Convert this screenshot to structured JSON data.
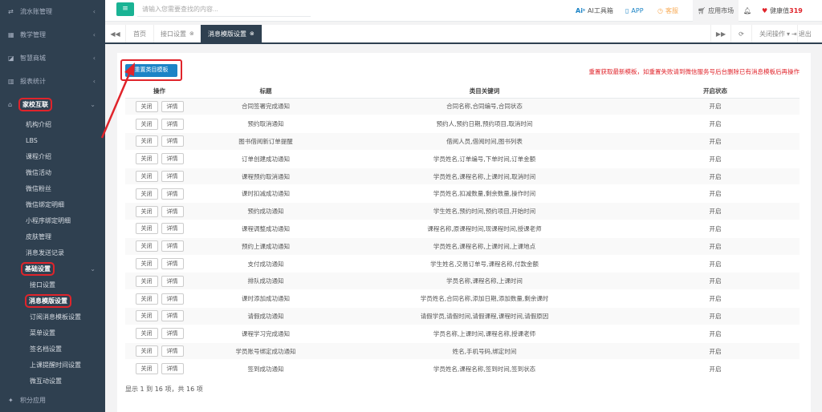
{
  "sidebar": {
    "top_items": [
      {
        "icon": "exchange-icon",
        "label": "流水账管理"
      },
      {
        "icon": "calendar-icon",
        "label": "教学管理"
      },
      {
        "icon": "shop-icon",
        "label": "智慧商城"
      },
      {
        "icon": "bar-chart-icon",
        "label": "报表统计"
      }
    ],
    "home_school": {
      "icon": "home-school-icon",
      "label": "家校互联"
    },
    "sub_items": [
      "机构介绍",
      "LBS",
      "课程介绍",
      "微信活动",
      "微信粉丝",
      "微信绑定明细",
      "小程序绑定明细",
      "皮肤管理",
      "消息发送记录"
    ],
    "basic_group": "基础设置",
    "basic_items": [
      "接口设置",
      "消息模版设置",
      "订阅消息模板设置",
      "菜单设置",
      "签名档设置",
      "上课提醒时间设置",
      "微互动设置"
    ],
    "bottom_item": {
      "icon": "points-icon",
      "label": "积分应用"
    }
  },
  "topbar": {
    "menu_icon": "hamburger-icon",
    "search_placeholder": "请输入您需要查找的内容...",
    "ai_tools": "AI工具箱",
    "app": "APP",
    "service": "客服",
    "app_market": "应用市场",
    "health_label": "健康值",
    "health_value": "319",
    "colors": {
      "ai": "#1c84c6",
      "app": "#1c84c6",
      "service": "#f8ac59",
      "health": "#e0242b"
    }
  },
  "tabbar": {
    "tabs": [
      {
        "label": "首页"
      },
      {
        "label": "接口设置"
      },
      {
        "label": "消息模版设置"
      }
    ],
    "close_ops": "关闭操作",
    "logout": "退出"
  },
  "panel": {
    "reset_button": "重置类目模板",
    "notice": "重置获取最新模板，如重置失败请到微信服务号后台删除已有消息模板后再操作",
    "headers": [
      "操作",
      "标题",
      "类目关键词",
      "开启状态"
    ],
    "op_close": "关闭",
    "op_detail": "详情",
    "rows": [
      {
        "title": "合同签署完成通知",
        "keywords": "合同名称,合同编号,合同状态",
        "status": "开启"
      },
      {
        "title": "预约取消通知",
        "keywords": "预约人,预约日期,预约项目,取消时间",
        "status": "开启"
      },
      {
        "title": "图书借阅新订单提醒",
        "keywords": "借阅人员,借阅时间,图书列表",
        "status": "开启"
      },
      {
        "title": "订单创建成功通知",
        "keywords": "学员姓名,订单编号,下单时间,订单金额",
        "status": "开启"
      },
      {
        "title": "课程预约取消通知",
        "keywords": "学员姓名,课程名称,上课时间,取消时间",
        "status": "开启"
      },
      {
        "title": "课时扣减成功通知",
        "keywords": "学员姓名,扣减数量,剩余数量,操作时间",
        "status": "开启"
      },
      {
        "title": "预约成功通知",
        "keywords": "学生姓名,预约时间,预约项目,开始时间",
        "status": "开启"
      },
      {
        "title": "课程调整成功通知",
        "keywords": "课程名称,原课程时间,现课程时间,授课老师",
        "status": "开启"
      },
      {
        "title": "预约上课成功通知",
        "keywords": "学员姓名,课程名称,上课时间,上课地点",
        "status": "开启"
      },
      {
        "title": "支付成功通知",
        "keywords": "学生姓名,交易订单号,课程名称,付款金额",
        "status": "开启"
      },
      {
        "title": "排队成功通知",
        "keywords": "学员名称,课程名称,上课时间",
        "status": "开启"
      },
      {
        "title": "课时添加成功通知",
        "keywords": "学员姓名,合同名称,添加日期,添加数量,剩余课时",
        "status": "开启"
      },
      {
        "title": "请假成功通知",
        "keywords": "请假学员,请假时间,请假课程,课程时间,请假原因",
        "status": "开启"
      },
      {
        "title": "课程学习完成通知",
        "keywords": "学员名称,上课时间,课程名称,授课老师",
        "status": "开启"
      },
      {
        "title": "学员账号绑定成功通知",
        "keywords": "姓名,手机号码,绑定时间",
        "status": "开启"
      },
      {
        "title": "签到成功通知",
        "keywords": "学员姓名,课程名称,签到时间,签到状态",
        "status": "开启"
      }
    ],
    "footer": "显示 1 到 16 项，共 16 项"
  }
}
